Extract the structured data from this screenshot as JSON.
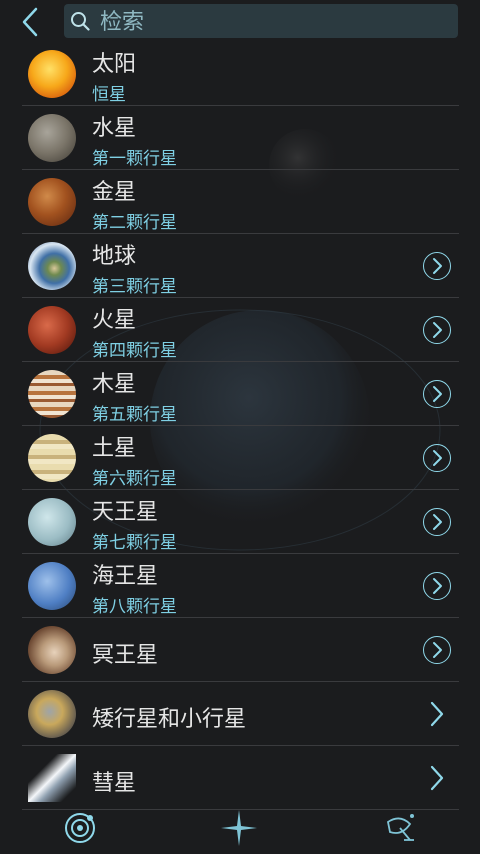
{
  "search": {
    "placeholder": "检索",
    "icon": "search-icon"
  },
  "accent": "#7fd0e4",
  "items": [
    {
      "name": "太阳",
      "sub": "恒星",
      "thumb": "sun",
      "arrow": "none"
    },
    {
      "name": "水星",
      "sub": "第一颗行星",
      "thumb": "mercury",
      "arrow": "none"
    },
    {
      "name": "金星",
      "sub": "第二颗行星",
      "thumb": "venus",
      "arrow": "none"
    },
    {
      "name": "地球",
      "sub": "第三颗行星",
      "thumb": "earth",
      "arrow": "circle"
    },
    {
      "name": "火星",
      "sub": "第四颗行星",
      "thumb": "mars",
      "arrow": "circle"
    },
    {
      "name": "木星",
      "sub": "第五颗行星",
      "thumb": "jupiter",
      "arrow": "circle"
    },
    {
      "name": "土星",
      "sub": "第六颗行星",
      "thumb": "saturn",
      "arrow": "circle"
    },
    {
      "name": "天王星",
      "sub": "第七颗行星",
      "thumb": "uranus",
      "arrow": "circle"
    },
    {
      "name": "海王星",
      "sub": "第八颗行星",
      "thumb": "neptune",
      "arrow": "circle"
    },
    {
      "name": "冥王星",
      "sub": "",
      "thumb": "pluto",
      "arrow": "circle"
    },
    {
      "name": "矮行星和小行星",
      "sub": "",
      "thumb": "dwarf",
      "arrow": "chevron"
    },
    {
      "name": "彗星",
      "sub": "",
      "thumb": "comet",
      "arrow": "chevron"
    }
  ],
  "nav": [
    {
      "icon": "solar-system-icon",
      "active": true
    },
    {
      "icon": "star-sparkle-icon",
      "active": false
    },
    {
      "icon": "satellite-icon",
      "active": false
    }
  ]
}
